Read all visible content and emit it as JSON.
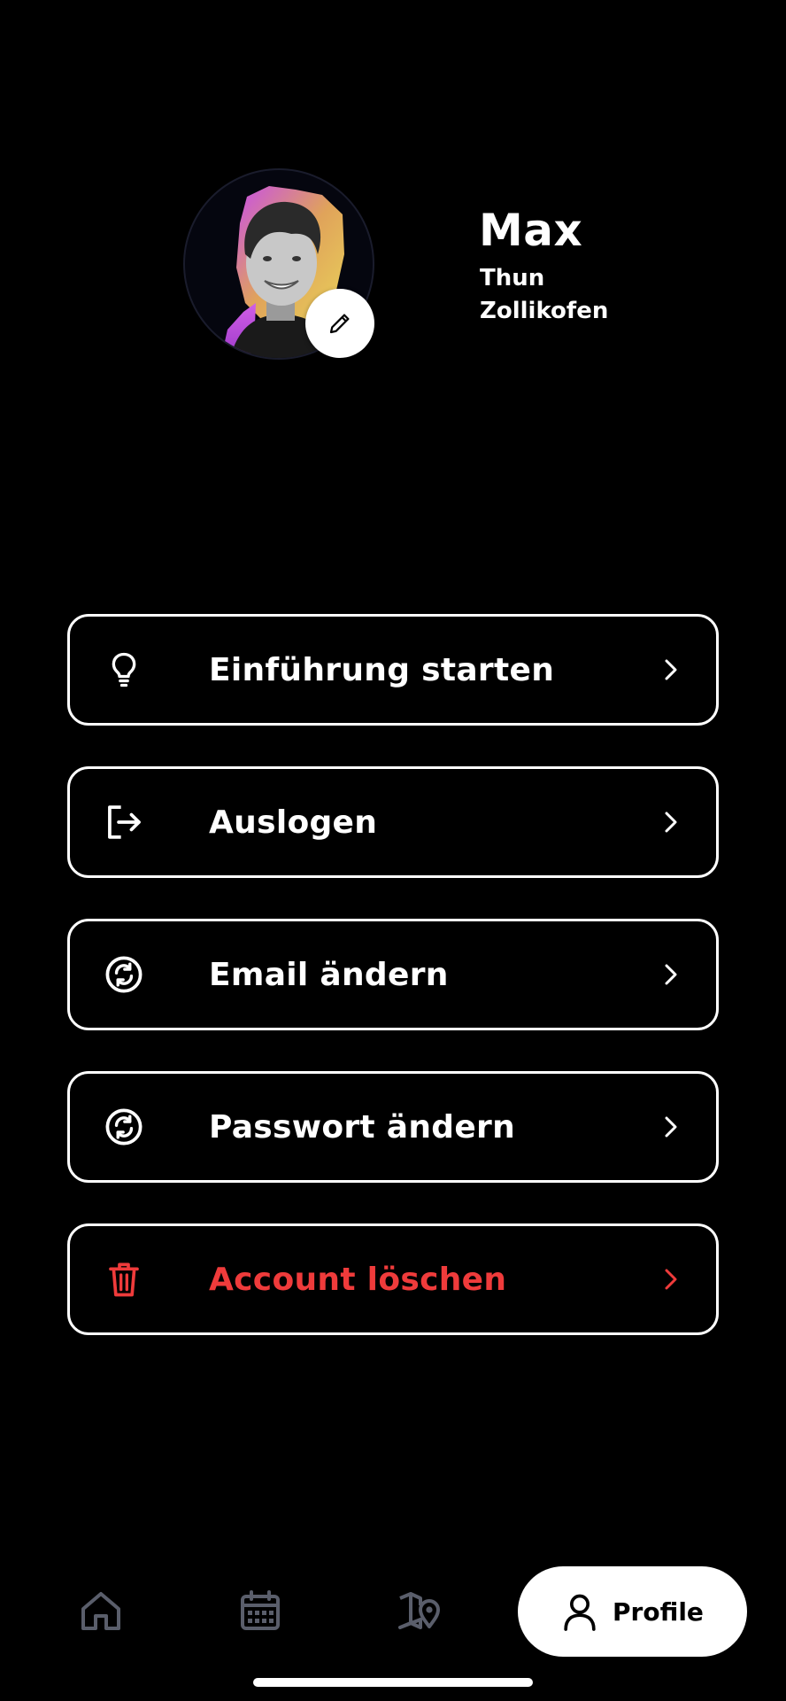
{
  "profile": {
    "name": "Max",
    "location_1": "Thun",
    "location_2": "Zollikofen",
    "avatar_icon": "user-photo",
    "edit_icon": "pencil-icon"
  },
  "menu": {
    "items": [
      {
        "label": "Einführung starten",
        "icon": "lightbulb-icon"
      },
      {
        "label": "Auslogen",
        "icon": "logout-icon"
      },
      {
        "label": "Email ändern",
        "icon": "refresh-circle-icon"
      },
      {
        "label": "Passwort ändern",
        "icon": "refresh-circle-icon"
      },
      {
        "label": "Account löschen",
        "icon": "trash-icon",
        "color": "#ef3b3b"
      }
    ]
  },
  "nav": {
    "home_icon": "home-icon",
    "calendar_icon": "calendar-icon",
    "map_icon": "map-pin-icon",
    "profile_label": "Profile",
    "profile_icon": "user-icon"
  },
  "colors": {
    "background": "#000000",
    "foreground": "#ffffff",
    "danger": "#ef3b3b",
    "inactive_nav": "#5a5e6b"
  }
}
